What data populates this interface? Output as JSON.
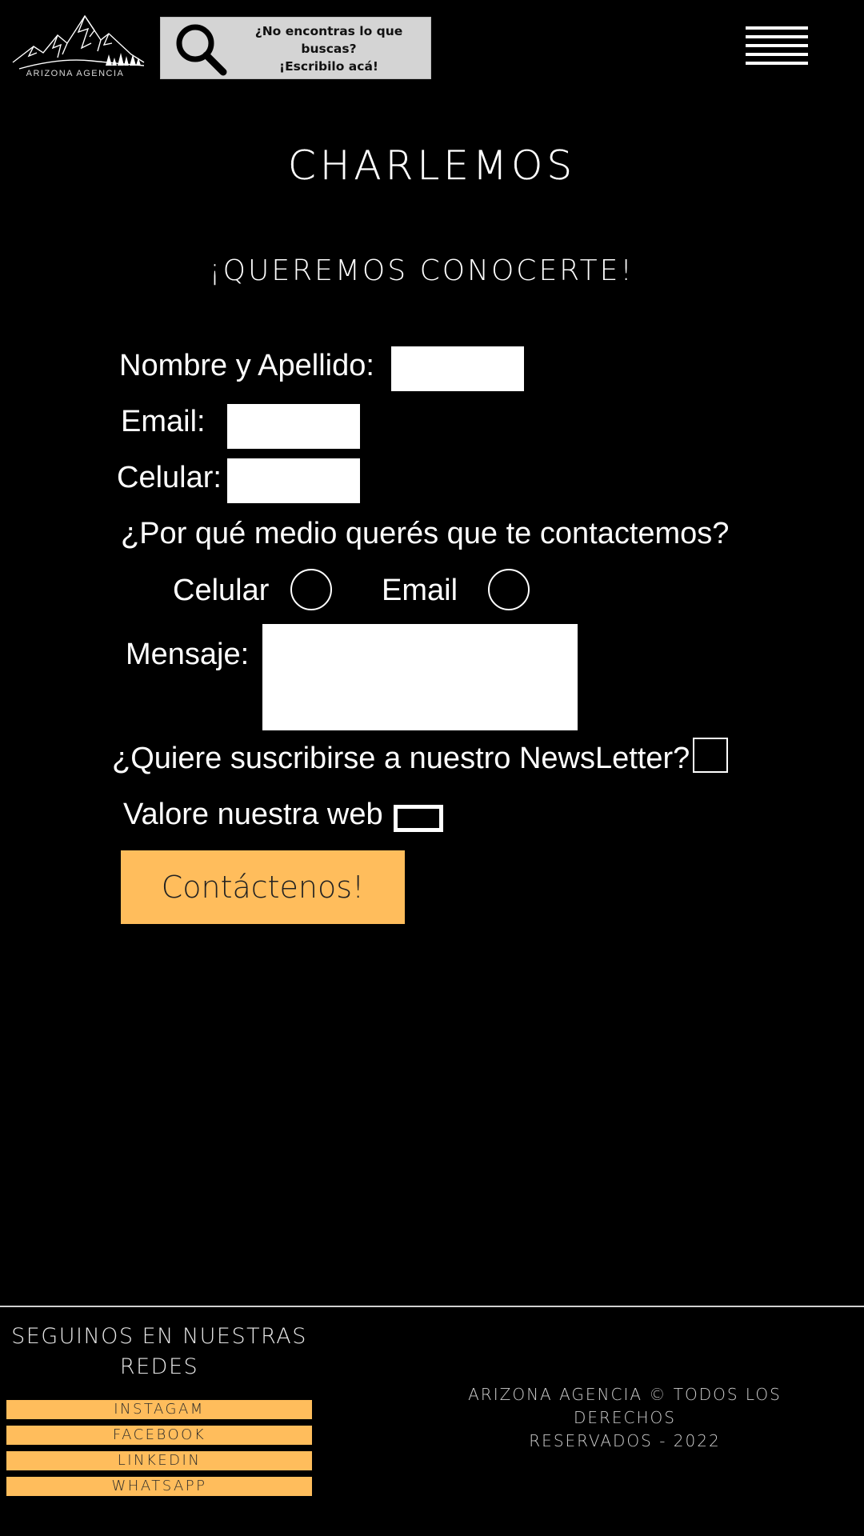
{
  "header": {
    "logo_text": "ARIZONA AGENCIA",
    "search_text_line1": "¿No encontras lo que",
    "search_text_line2": "buscas?",
    "search_text_line3": "¡Escribilo acá!",
    "menu_icon": "hamburger-icon",
    "search_icon": "search-icon",
    "search_box_color": "#d4d4d4"
  },
  "main": {
    "title": "CHARLEMOS",
    "subtitle": "¡QUEREMOS CONOCERTE!"
  },
  "form": {
    "name_label": "Nombre y Apellido:",
    "email_label": "Email:",
    "phone_label": "Celular:",
    "contact_question": "¿Por qué medio querés que te contactemos?",
    "radio_phone_label": "Celular",
    "radio_email_label": "Email",
    "message_label": "Mensaje:",
    "newsletter_question": "¿Quiere suscribirse a nuestro NewsLetter?",
    "rating_label": "Valore nuestra web",
    "submit_label": "Contáctenos!",
    "accent_color": "#ffbd5c"
  },
  "footer": {
    "follow_line1": "SEGUINOS EN NUESTRAS",
    "follow_line2": "REDES",
    "social_links": [
      "INSTAGAM",
      "FACEBOOK",
      "LINKEDIN",
      "WHATSAPP"
    ],
    "copyright_line1": "ARIZONA AGENCIA © TODOS LOS DERECHOS",
    "copyright_line2": "RESERVADOS - 2022"
  }
}
